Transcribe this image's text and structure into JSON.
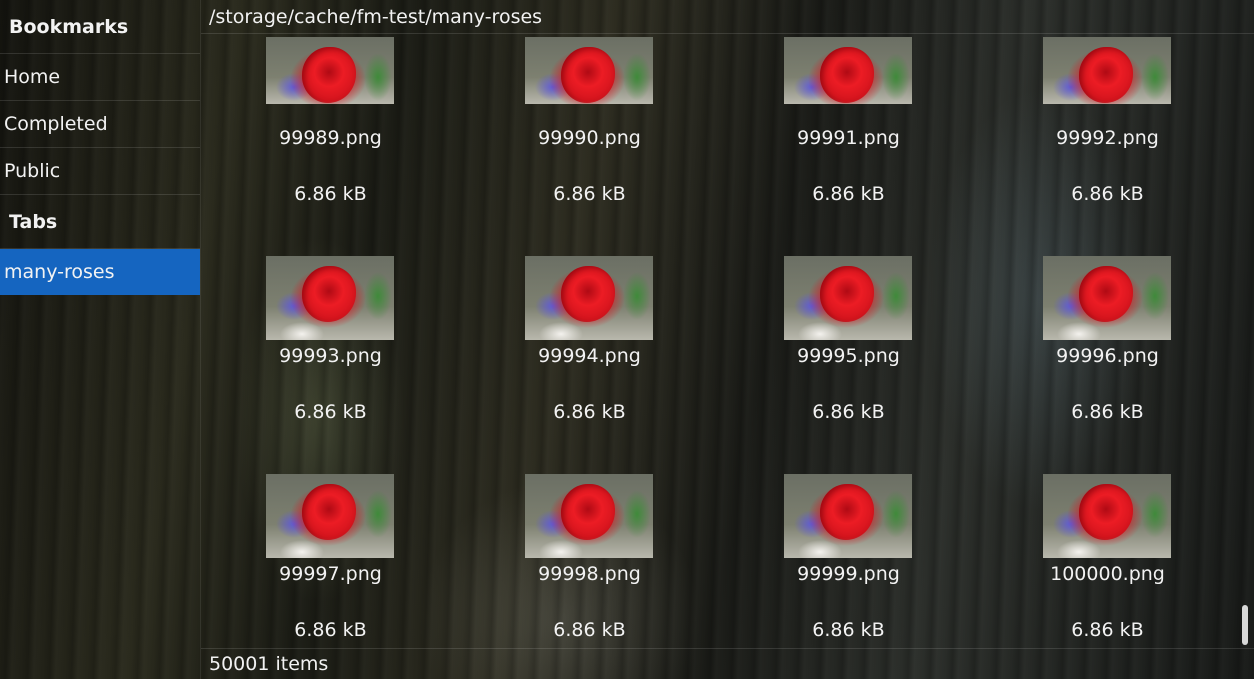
{
  "sidebar": {
    "bookmarks_header": "Bookmarks",
    "bookmarks": [
      {
        "label": "Home"
      },
      {
        "label": "Completed"
      },
      {
        "label": "Public"
      }
    ],
    "tabs_header": "Tabs",
    "tabs": [
      {
        "label": "many-roses",
        "selected": true
      }
    ]
  },
  "path": "/storage/cache/fm-test/many-roses",
  "files": [
    {
      "name": "99989.png",
      "size": "6.86 kB",
      "thumb": "rose-thumbnail"
    },
    {
      "name": "99990.png",
      "size": "6.86 kB",
      "thumb": "rose-thumbnail"
    },
    {
      "name": "99991.png",
      "size": "6.86 kB",
      "thumb": "rose-thumbnail"
    },
    {
      "name": "99992.png",
      "size": "6.86 kB",
      "thumb": "rose-thumbnail"
    },
    {
      "name": "99993.png",
      "size": "6.86 kB",
      "thumb": "rose-thumbnail"
    },
    {
      "name": "99994.png",
      "size": "6.86 kB",
      "thumb": "rose-thumbnail"
    },
    {
      "name": "99995.png",
      "size": "6.86 kB",
      "thumb": "rose-thumbnail"
    },
    {
      "name": "99996.png",
      "size": "6.86 kB",
      "thumb": "rose-thumbnail"
    },
    {
      "name": "99997.png",
      "size": "6.86 kB",
      "thumb": "rose-thumbnail"
    },
    {
      "name": "99998.png",
      "size": "6.86 kB",
      "thumb": "rose-thumbnail"
    },
    {
      "name": "99999.png",
      "size": "6.86 kB",
      "thumb": "rose-thumbnail"
    },
    {
      "name": "100000.png",
      "size": "6.86 kB",
      "thumb": "rose-thumbnail"
    }
  ],
  "status": "50001 items",
  "colors": {
    "selection": "#1565c0",
    "text": "#f2f2f2"
  }
}
